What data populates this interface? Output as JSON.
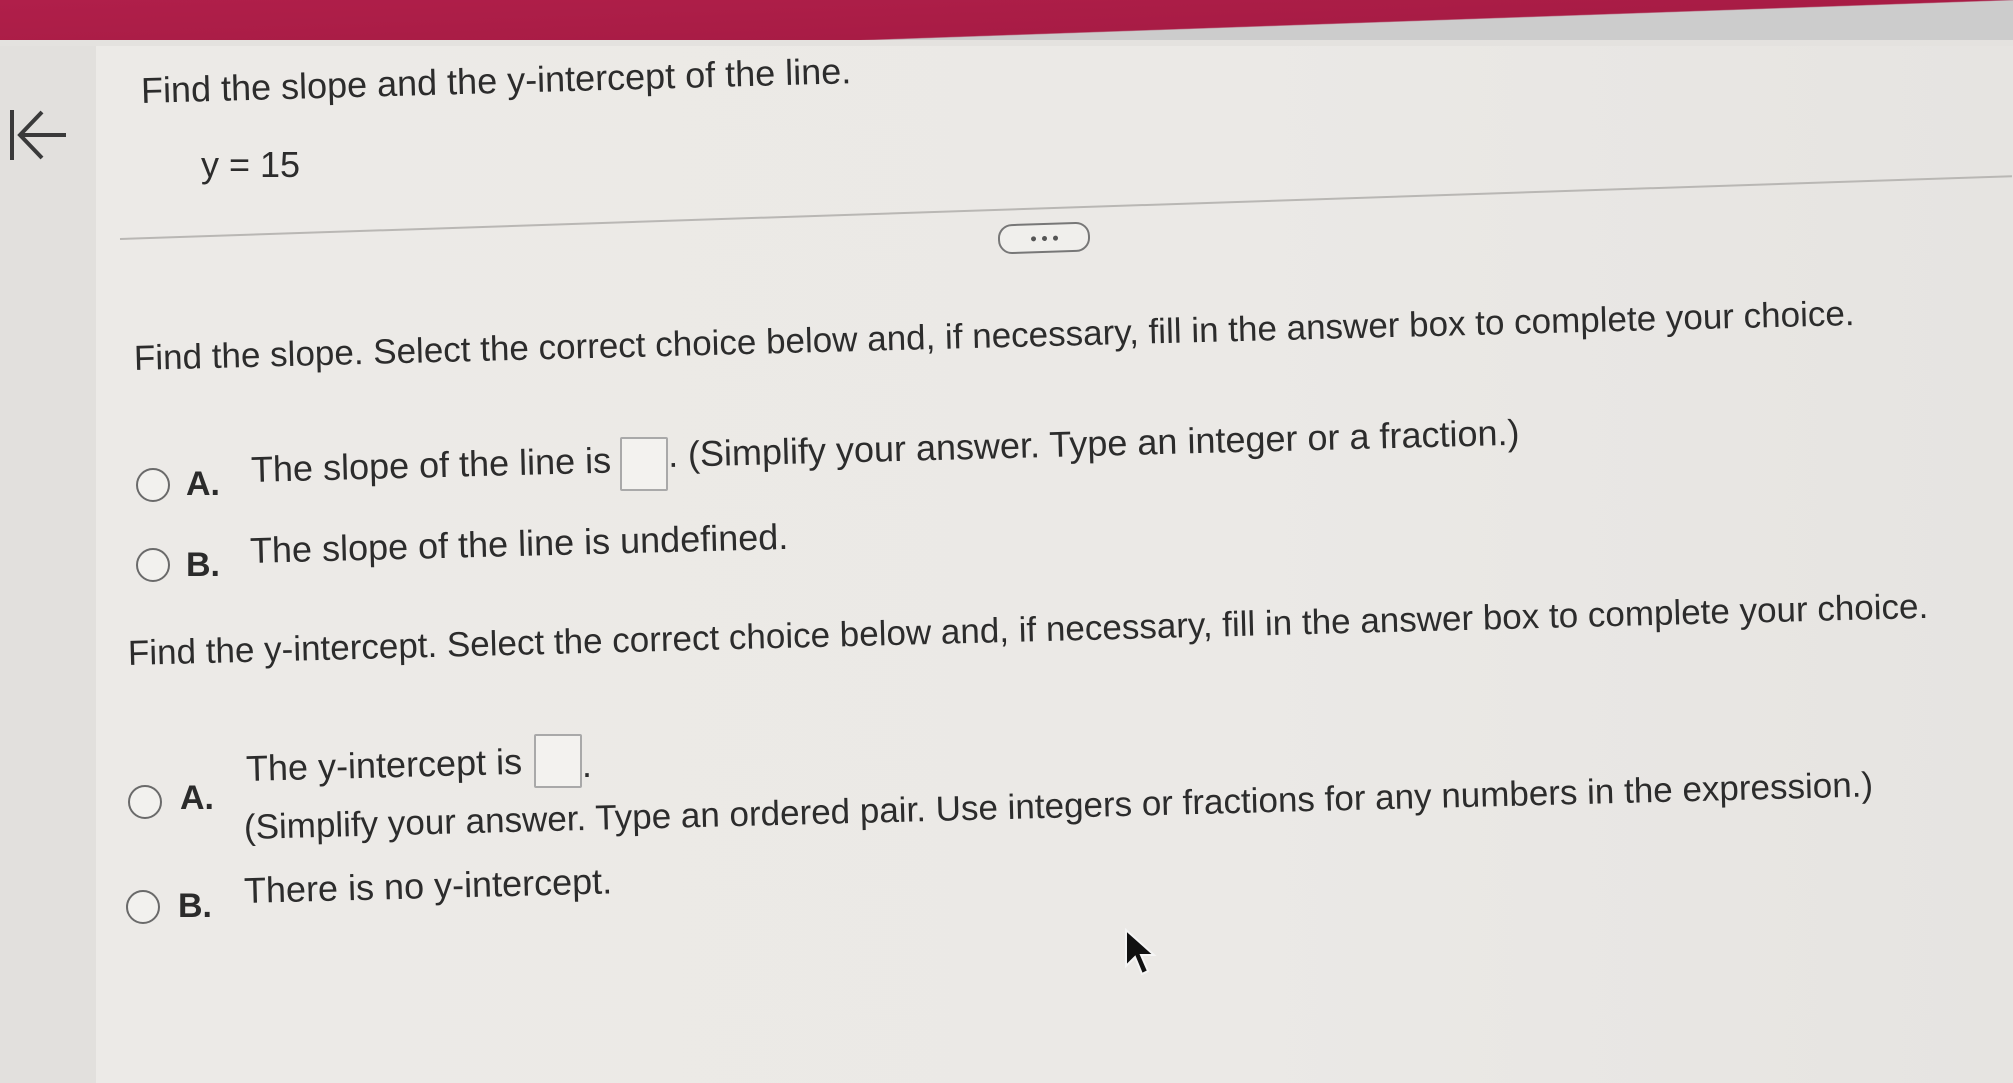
{
  "header": {
    "instruction": "Find the slope and the y-intercept of the line.",
    "equation": "y = 15"
  },
  "slope_section": {
    "prompt": "Find the slope. Select the correct choice below and, if necessary, fill in the answer box to complete your choice.",
    "choice_a": {
      "letter": "A.",
      "text_before": "The slope of the line is",
      "text_after": ". (Simplify your answer. Type an integer or a fraction.)",
      "answer_value": ""
    },
    "choice_b": {
      "letter": "B.",
      "text": "The slope of the line is undefined."
    }
  },
  "intercept_section": {
    "prompt": "Find the y-intercept. Select the correct choice below and, if necessary, fill in the answer box to complete your choice.",
    "choice_a": {
      "letter": "A.",
      "text_before": "The y-intercept is",
      "text_after": ".",
      "note": "(Simplify your answer. Type an ordered pair. Use integers or fractions for any numbers in the expression.)",
      "answer_value": ""
    },
    "choice_b": {
      "letter": "B.",
      "text": "There is no y-intercept."
    }
  },
  "icons": {
    "back": "back-to-start-icon",
    "more": "more-dots-icon",
    "cursor": "mouse-pointer-icon"
  },
  "colors": {
    "top_bar": "#a81c45",
    "background": "#ebe9e6",
    "text": "#2c2c2c"
  }
}
